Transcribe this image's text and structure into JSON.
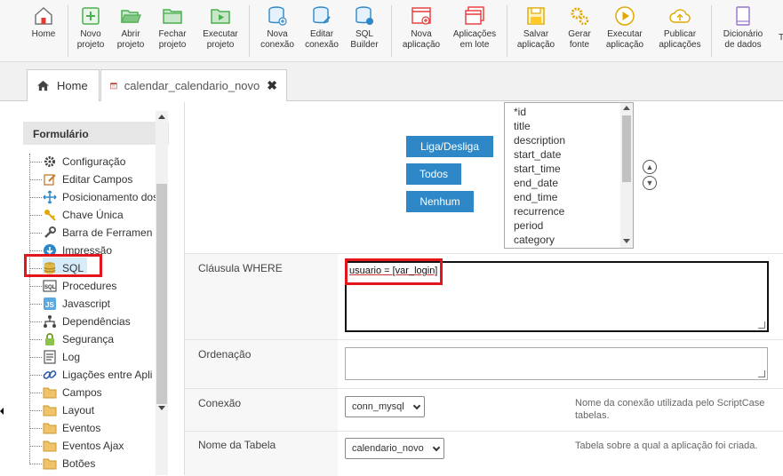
{
  "toolbar": {
    "items": [
      {
        "label1": "Home",
        "label2": "",
        "icon": "home-icon"
      },
      {
        "label1": "Novo",
        "label2": "projeto",
        "icon": "new-project-icon"
      },
      {
        "label1": "Abrir",
        "label2": "projeto",
        "icon": "open-folder-icon"
      },
      {
        "label1": "Fechar",
        "label2": "projeto",
        "icon": "close-folder-icon"
      },
      {
        "label1": "Executar",
        "label2": "projeto",
        "icon": "run-folder-icon"
      },
      {
        "label1": "Nova",
        "label2": "conexão",
        "icon": "new-connection-icon"
      },
      {
        "label1": "Editar",
        "label2": "conexão",
        "icon": "edit-connection-icon"
      },
      {
        "label1": "SQL",
        "label2": "Builder",
        "icon": "sql-builder-icon"
      },
      {
        "label1": "Nova",
        "label2": "aplicação",
        "icon": "new-app-icon"
      },
      {
        "label1": "Aplicações",
        "label2": "em lote",
        "icon": "batch-apps-icon"
      },
      {
        "label1": "Salvar",
        "label2": "aplicação",
        "icon": "save-icon"
      },
      {
        "label1": "Gerar",
        "label2": "fonte",
        "icon": "gears-icon"
      },
      {
        "label1": "Executar",
        "label2": "aplicação",
        "icon": "play-icon"
      },
      {
        "label1": "Publicar",
        "label2": "aplicações",
        "icon": "cloud-upload-icon"
      },
      {
        "label1": "Dicionário",
        "label2": "de dados",
        "icon": "dictionary-icon"
      }
    ]
  },
  "tabs": [
    {
      "label": "Home",
      "icon": "home-icon"
    },
    {
      "label": "calendar_calendario_novo",
      "icon": "calendar-icon"
    }
  ],
  "tree": {
    "header": "Formulário",
    "items": [
      {
        "label": "Configuração",
        "icon": "gear-icon"
      },
      {
        "label": "Editar Campos",
        "icon": "edit-icon"
      },
      {
        "label": "Posicionamento dos",
        "icon": "move-icon"
      },
      {
        "label": "Chave Única",
        "icon": "key-icon"
      },
      {
        "label": "Barra de Ferramen",
        "icon": "wrench-icon"
      },
      {
        "label": "Impressão",
        "icon": "print-icon"
      },
      {
        "label": "SQL",
        "icon": "database-icon"
      },
      {
        "label": "Procedures",
        "icon": "sql-icon"
      },
      {
        "label": "Javascript",
        "icon": "javascript-icon"
      },
      {
        "label": "Dependências",
        "icon": "dependency-icon"
      },
      {
        "label": "Segurança",
        "icon": "lock-icon"
      },
      {
        "label": "Log",
        "icon": "log-icon"
      },
      {
        "label": "Ligações entre Apli",
        "icon": "link-icon"
      },
      {
        "label": "Campos",
        "icon": "folder-icon"
      },
      {
        "label": "Layout",
        "icon": "folder-icon"
      },
      {
        "label": "Eventos",
        "icon": "folder-icon"
      },
      {
        "label": "Eventos Ajax",
        "icon": "folder-icon"
      },
      {
        "label": "Botões",
        "icon": "folder-icon"
      }
    ]
  },
  "main": {
    "buttons": {
      "toggle": "Liga/Desliga",
      "all": "Todos",
      "none": "Nenhum"
    },
    "fields": [
      "*id",
      "title",
      "description",
      "start_date",
      "start_time",
      "end_date",
      "end_time",
      "recurrence",
      "period",
      "category"
    ],
    "where": {
      "label": "Cláusula WHERE",
      "value": "usuario = [var_login]"
    },
    "order": {
      "label": "Ordenação",
      "value": ""
    },
    "connection": {
      "label": "Conexão",
      "value": "conn_mysql",
      "hint1": "Nome da conexão utilizada pelo ScriptCase",
      "hint2": "tabelas."
    },
    "table": {
      "label": "Nome da Tabela",
      "value": "calendario_novo",
      "hint": "Tabela sobre a qual a aplicação foi criada."
    }
  },
  "colors": {
    "accent": "#2e88c8",
    "highlight": "#e3161b",
    "toolbar_green": "#4caf50"
  }
}
